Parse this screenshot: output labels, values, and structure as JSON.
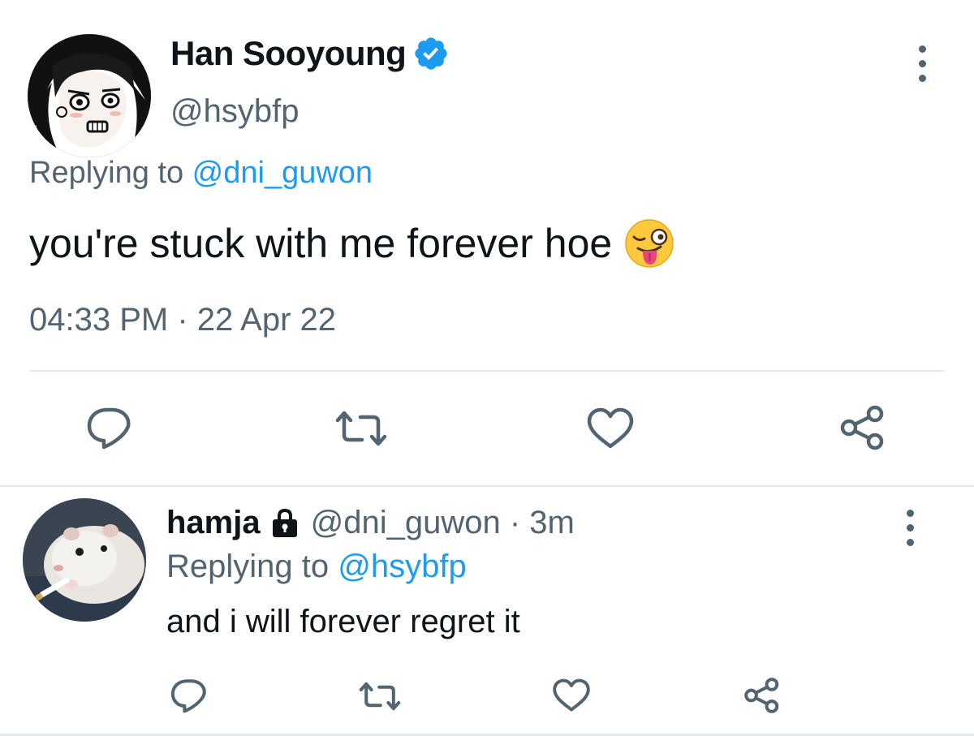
{
  "colors": {
    "link": "#1d9bf0",
    "secondary_text": "#536471",
    "primary_text": "#0f1419",
    "divider": "#e6e9eb"
  },
  "main_tweet": {
    "display_name": "Han Sooyoung",
    "verified_icon": "verified-badge-icon",
    "handle": "@hsybfp",
    "replying_to_prefix": "Replying to ",
    "replying_to_handle": "@dni_guwon",
    "text": "you're stuck with me forever hoe",
    "emoji_icon": "winking-face-with-tongue-icon",
    "timestamp": "04:33 PM · 22 Apr 22",
    "actions": [
      "reply-icon",
      "retweet-icon",
      "like-icon",
      "share-icon"
    ]
  },
  "reply_tweet": {
    "display_name": "hamja",
    "protected_icon": "lock-icon",
    "handle_time": "@dni_guwon · 3m",
    "replying_to_prefix": "Replying to ",
    "replying_to_handle": "@hsybfp",
    "text": "and i will forever regret it",
    "actions": [
      "reply-icon",
      "retweet-icon",
      "like-icon",
      "share-icon"
    ]
  }
}
